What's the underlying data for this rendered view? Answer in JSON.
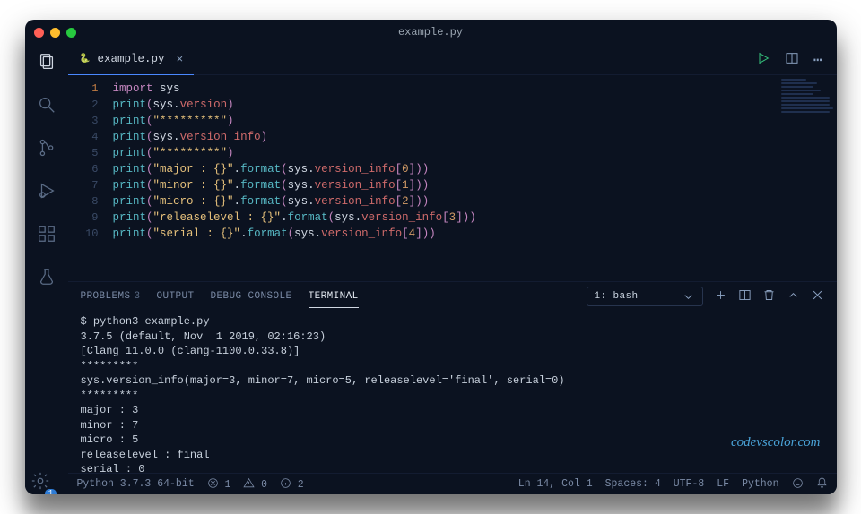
{
  "title": "example.py",
  "tab": {
    "filename": "example.py"
  },
  "actions": {
    "more": "⋯"
  },
  "code_lines": [
    "import sys",
    "print(sys.version)",
    "print(\"*********\")",
    "print(sys.version_info)",
    "print(\"*********\")",
    "print(\"major : {}\".format(sys.version_info[0]))",
    "print(\"minor : {}\".format(sys.version_info[1]))",
    "print(\"micro : {}\".format(sys.version_info[2]))",
    "print(\"releaselevel : {}\".format(sys.version_info[3]))",
    "print(\"serial : {}\".format(sys.version_info[4]))"
  ],
  "panel": {
    "tabs": {
      "problems": "Problems",
      "problems_count": "3",
      "output": "Output",
      "debug": "Debug Console",
      "terminal": "Terminal"
    },
    "shell_label": "1: bash"
  },
  "terminal": {
    "cmd": "$ python3 example.py",
    "out": [
      "3.7.5 (default, Nov  1 2019, 02:16:23)",
      "[Clang 11.0.0 (clang-1100.0.33.8)]",
      "*********",
      "sys.version_info(major=3, minor=7, micro=5, releaselevel='final', serial=0)",
      "*********",
      "major : 3",
      "minor : 7",
      "micro : 5",
      "releaselevel : final",
      "serial : 0"
    ],
    "prompt": "$ "
  },
  "watermark": "codevscolor.com",
  "status": {
    "python": "Python 3.7.3 64-bit",
    "err_x": "1",
    "err_warn": "0",
    "err_info": "2",
    "ln_col": "Ln 14, Col 1",
    "spaces": "Spaces: 4",
    "enc": "UTF-8",
    "eol": "LF",
    "lang": "Python"
  },
  "gear_badge": "1"
}
